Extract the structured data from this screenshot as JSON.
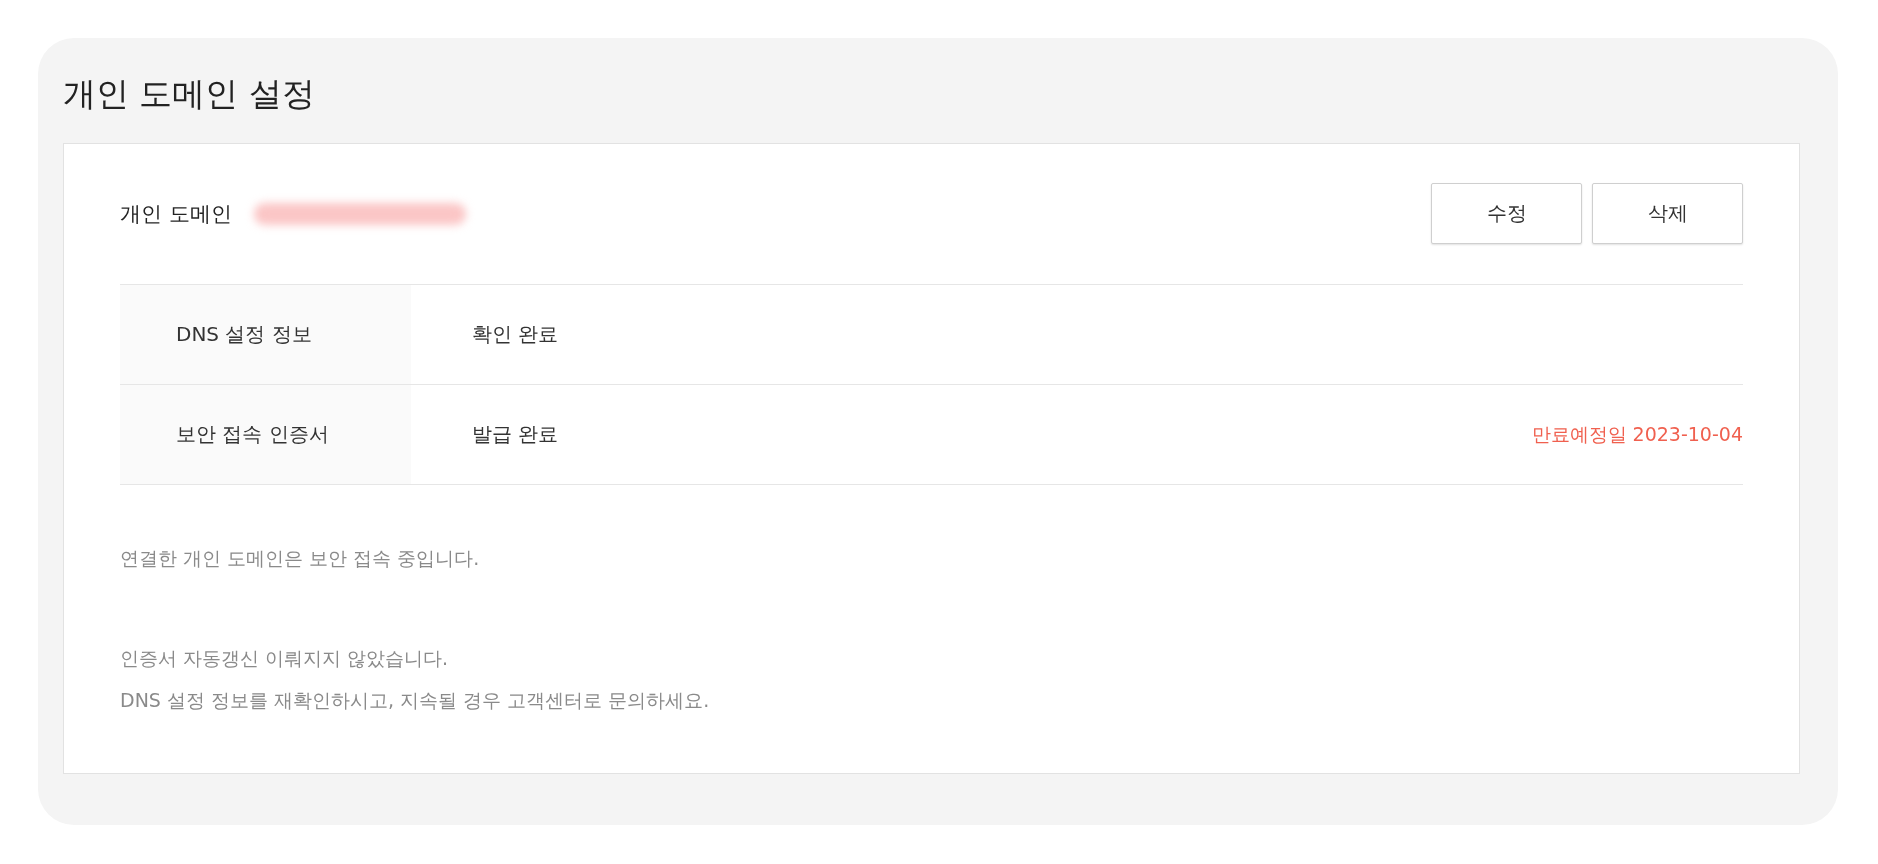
{
  "page": {
    "title": "개인 도메인 설정"
  },
  "domain": {
    "label": "개인 도메인",
    "value_blurred": true
  },
  "buttons": [
    "수정",
    "삭제"
  ],
  "rows": [
    {
      "label": "DNS 설정 정보",
      "value": "확인 완료"
    },
    {
      "label": "보안 접속 인증서",
      "value": "발급 완료",
      "note": "만료예정일 2023-10-04"
    }
  ],
  "messages": [
    {
      "lines": [
        "연결한 개인 도메인은 보안 접속 중입니다."
      ]
    },
    {
      "lines": [
        "인증서 자동갱신 이뤄지지 않았습니다.",
        "DNS 설정 정보를 재확인하시고, 지속될 경우 고객센터로 문의하세요."
      ]
    }
  ]
}
